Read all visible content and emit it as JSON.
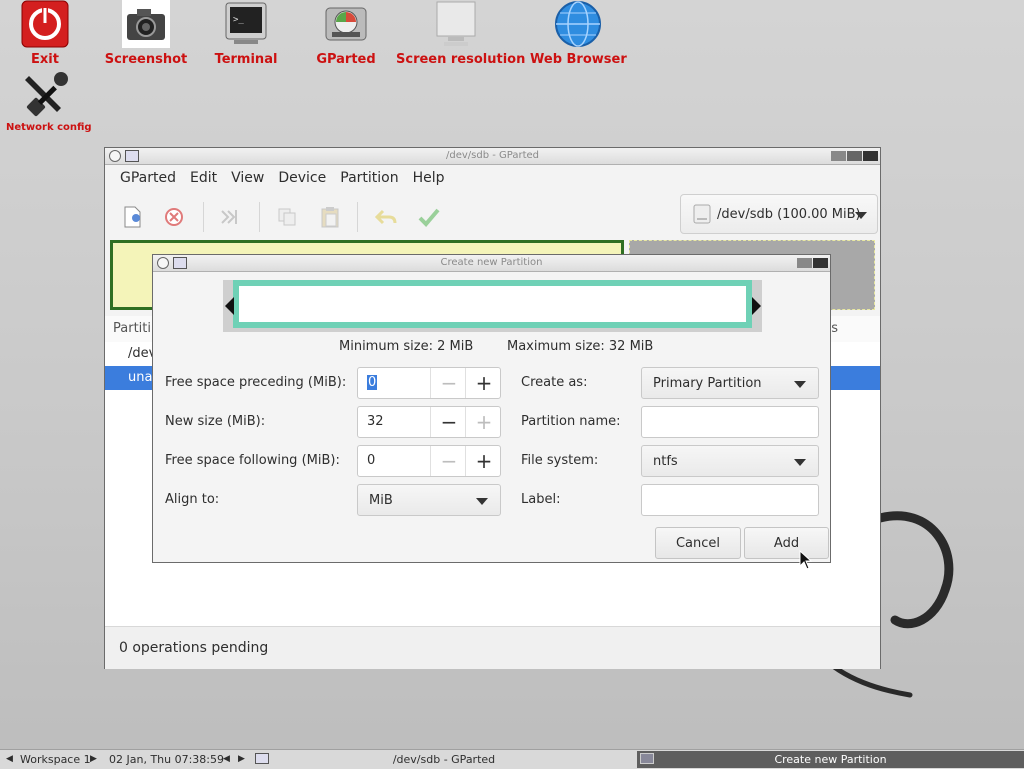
{
  "desktop": {
    "icons": [
      {
        "label": "Exit",
        "icon": "power-icon"
      },
      {
        "label": "Screenshot",
        "icon": "camera-icon"
      },
      {
        "label": "Terminal",
        "icon": "terminal-icon"
      },
      {
        "label": "GParted",
        "icon": "gparted-icon"
      },
      {
        "label": "Screen resolution",
        "icon": "monitor-icon"
      },
      {
        "label": "Web Browser",
        "icon": "globe-icon"
      },
      {
        "label": "Network config",
        "icon": "tools-icon"
      }
    ]
  },
  "gparted": {
    "title": "/dev/sdb - GParted",
    "menu": [
      "GParted",
      "Edit",
      "View",
      "Device",
      "Partition",
      "Help"
    ],
    "device_combo": "/dev/sdb (100.00 MiB)",
    "partition_col_header": "Partiti",
    "flags_col_header": "s",
    "rows": [
      "/dev",
      "una"
    ],
    "status": "0 operations pending"
  },
  "dialog": {
    "title": "Create new Partition",
    "min_size": "Minimum size: 2 MiB",
    "max_size": "Maximum size: 32 MiB",
    "fields": {
      "free_preceding_label": "Free space preceding (MiB):",
      "free_preceding_value": "0",
      "new_size_label": "New size (MiB):",
      "new_size_value": "32",
      "free_following_label": "Free space following (MiB):",
      "free_following_value": "0",
      "align_label": "Align to:",
      "align_value": "MiB",
      "create_as_label": "Create as:",
      "create_as_value": "Primary Partition",
      "partition_name_label": "Partition name:",
      "partition_name_value": "",
      "filesystem_label": "File system:",
      "filesystem_value": "ntfs",
      "label_label": "Label:",
      "label_value": ""
    },
    "buttons": {
      "cancel": "Cancel",
      "add": "Add"
    }
  },
  "taskbar": {
    "workspace": "Workspace 1",
    "datetime": "02 Jan, Thu 07:38:59",
    "task1": "/dev/sdb - GParted",
    "task2": "Create new Partition"
  },
  "colors": {
    "desktop_label": "#cc1111",
    "selection": "#3b7ddd",
    "partition_bar": "#6fd1b6",
    "used_partition": "#f4f4b9"
  }
}
